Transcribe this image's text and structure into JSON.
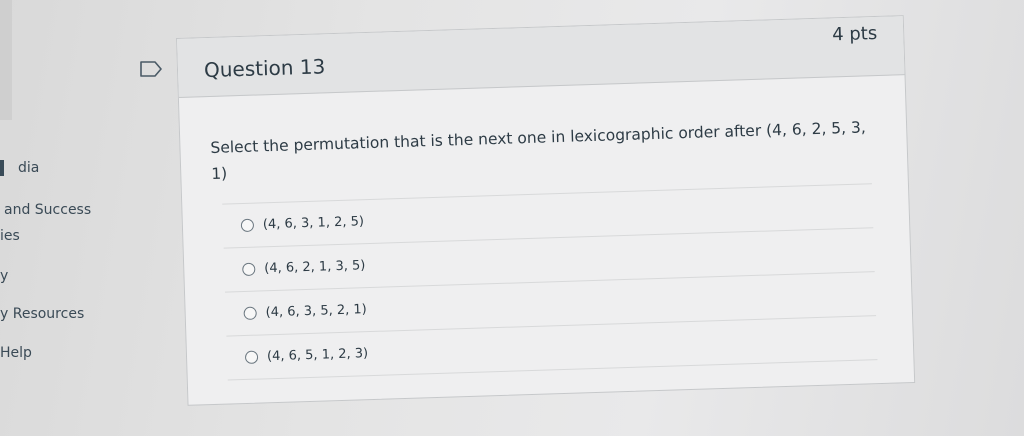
{
  "sidebar": {
    "items": [
      {
        "label": "dia"
      },
      {
        "label": "and Success"
      },
      {
        "label": "ies"
      },
      {
        "label": "y"
      },
      {
        "label": "y Resources"
      },
      {
        "label": "Help"
      }
    ]
  },
  "question": {
    "title": "Question 13",
    "points": "4 pts",
    "text": "Select the permutation that is the next one in lexicographic order after (4, 6, 2, 5, 3, 1)",
    "answers": [
      {
        "label": "(4, 6, 3, 1, 2, 5)"
      },
      {
        "label": "(4, 6, 2, 1, 3, 5)"
      },
      {
        "label": "(4, 6, 3, 5, 2, 1)"
      },
      {
        "label": "(4, 6, 5, 1, 2, 3)"
      }
    ]
  },
  "icons": {
    "flag": "flag-question-icon",
    "radio": "radio-button-icon"
  },
  "colors": {
    "text": "#2d3b45",
    "header_bg": "#e2e3e4",
    "card_bg": "#efeff0"
  }
}
